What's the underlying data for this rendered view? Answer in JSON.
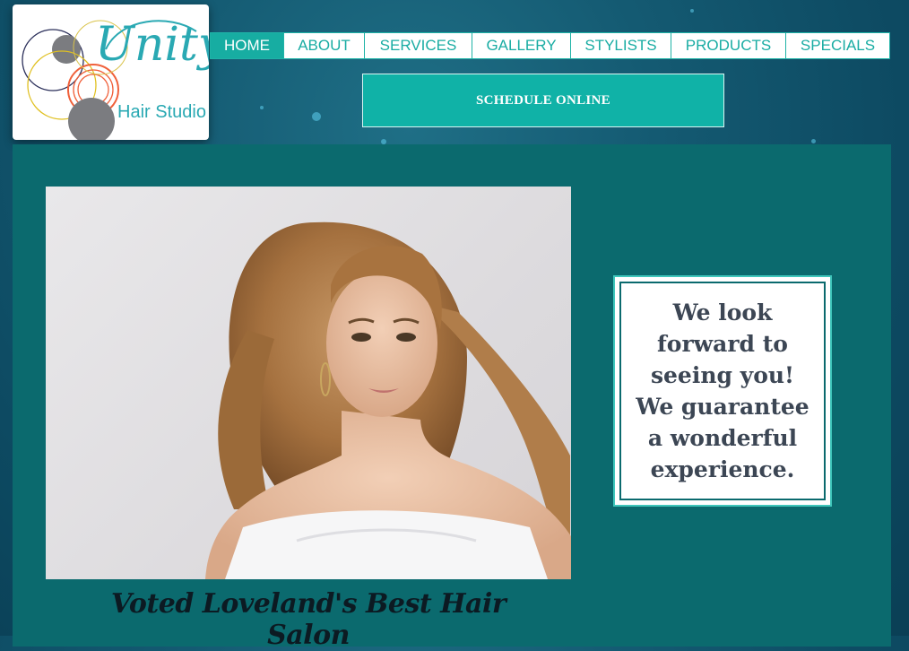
{
  "logo": {
    "wordmark": "Unity",
    "subtitle": "Hair Studio"
  },
  "nav": {
    "items": [
      {
        "label": "HOME",
        "active": true
      },
      {
        "label": "ABOUT",
        "active": false
      },
      {
        "label": "SERVICES",
        "active": false
      },
      {
        "label": "GALLERY",
        "active": false
      },
      {
        "label": "STYLISTS",
        "active": false
      },
      {
        "label": "PRODUCTS",
        "active": false
      },
      {
        "label": "SPECIALS",
        "active": false
      }
    ]
  },
  "cta": {
    "label": "SCHEDULE ONLINE"
  },
  "main": {
    "caption": "Voted Loveland's Best Hair Salon",
    "quote": "We look forward to seeing you! We guarantee a wonderful experience."
  },
  "colors": {
    "teal_accent": "#17ada2",
    "content_bg": "#0b6a6e",
    "page_bg": "#0d4a62"
  }
}
